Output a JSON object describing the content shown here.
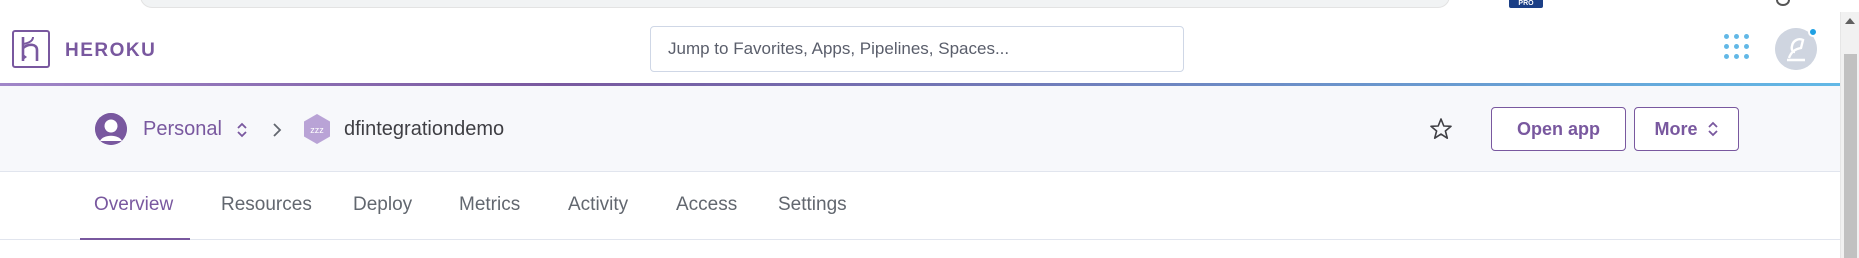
{
  "browser": {
    "badge": "PRO"
  },
  "topbar": {
    "brand": "HEROKU",
    "search": {
      "placeholder": "Jump to Favorites, Apps, Pipelines, Spaces..."
    },
    "icons": {
      "apps_menu": "apps-grid-icon",
      "account": "account-avatar-icon"
    },
    "accent_colors": {
      "brand": "#79589f",
      "highlight": "#62b8e6"
    }
  },
  "app_header": {
    "account_label": "Personal",
    "app_name": "dfintegrationdemo",
    "app_icon_text": "zzz",
    "open_app_label": "Open app",
    "more_label": "More"
  },
  "tabs": [
    {
      "label": "Overview",
      "active": true
    },
    {
      "label": "Resources",
      "active": false
    },
    {
      "label": "Deploy",
      "active": false
    },
    {
      "label": "Metrics",
      "active": false
    },
    {
      "label": "Activity",
      "active": false
    },
    {
      "label": "Access",
      "active": false
    },
    {
      "label": "Settings",
      "active": false
    }
  ]
}
